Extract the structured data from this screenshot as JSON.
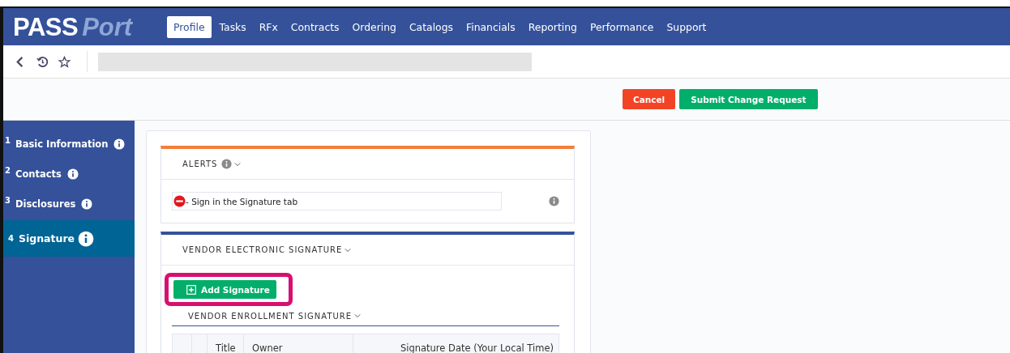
{
  "header": {
    "logo": {
      "part_1": "PASS",
      "part_2": "Port"
    },
    "nav": [
      {
        "label": "Profile",
        "selected": true
      },
      {
        "label": "Tasks",
        "selected": false
      },
      {
        "label": "RFx",
        "selected": false
      },
      {
        "label": "Contracts",
        "selected": false
      },
      {
        "label": "Ordering",
        "selected": false
      },
      {
        "label": "Catalogs",
        "selected": false
      },
      {
        "label": "Financials",
        "selected": false
      },
      {
        "label": "Reporting",
        "selected": false
      },
      {
        "label": "Performance",
        "selected": false
      },
      {
        "label": "Support",
        "selected": false
      }
    ]
  },
  "actions": [
    {
      "label": "Cancel",
      "kind": "cancel"
    },
    {
      "label": "Submit Change Request",
      "kind": "submit"
    }
  ],
  "sidebar": {
    "items": [
      {
        "number": "1",
        "label": "Basic Information",
        "selected": false
      },
      {
        "number": "2",
        "label": "Contacts",
        "selected": false
      },
      {
        "number": "3",
        "label": "Disclosures",
        "selected": false
      },
      {
        "number": "4",
        "label": "Signature",
        "selected": true
      }
    ]
  },
  "alerts": {
    "title": "ALERTS",
    "items": [
      {
        "text": "- Sign in the Signature tab"
      }
    ]
  },
  "signature_section": {
    "title": "VENDOR ELECTRONIC SIGNATURE",
    "add_button": {
      "label": "Add Signature",
      "highlighted": true
    },
    "subsection": {
      "title": "VENDOR ENROLLMENT SIGNATURE",
      "table": {
        "columns": [
          "",
          "",
          "Title",
          "Owner",
          "Signature Date (Your Local Time)"
        ]
      }
    }
  }
}
